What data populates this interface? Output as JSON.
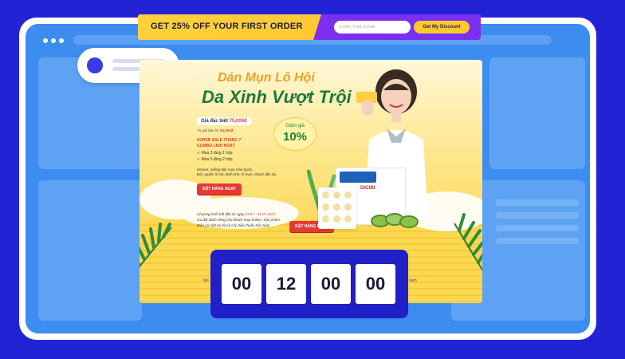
{
  "promo": {
    "headline": "GET 25% OFF YOUR FIRST ORDER",
    "email_placeholder": "Enter Your Email",
    "button_label": "Get My Discount"
  },
  "landing": {
    "title_line1": "Dán Mụn Lô Hội",
    "title_line2": "Da Xinh Vượt Trội",
    "price_label": "Giá đặc biệt",
    "price_value": "75,000đ",
    "old_price_label": "Từ giá bán lẻ:",
    "old_price_value": "94,000đ",
    "discount_label": "Giảm giá",
    "discount_value": "10%",
    "sale_heading_1": "SUPER SALE THÁNG 7",
    "sale_heading_2": "COMBO LINH HOẠT",
    "sale_items": [
      "Mua 3 tặng 1 hộp",
      "Mua 5 tặng 2 hộp"
    ],
    "desc_line1": "Himom, miếng dán mụn Hàn Quốc.",
    "desc_line2": "Độc quyền lô hội, lành tính, trị mụn, nhanh liền da.",
    "cta_primary": "ĐẶT HÀNG NGAY",
    "program_line1_prefix": "Chương trình bắt đầu từ ngày",
    "program_dates": "01.07 - 31.07.2021",
    "program_line2": "Ưu đãi dành riêng cho khách mua online. Sản phẩm",
    "program_line3": "Biện có mặt tại tất cả các hiệu thuốc trên toàn",
    "cta_secondary": "ĐẶT HÀNG NGAY",
    "product_name": "DIGIBI",
    "footer_left": "Me",
    "footer_right": "bám"
  },
  "countdown": [
    "00",
    "12",
    "00",
    "00"
  ],
  "colors": {
    "background": "#2323d6",
    "browser_fill": "#3d8cf0",
    "promo_yellow": "#ffd03c",
    "promo_purple": "#7b2ff0",
    "cta_red": "#e53935",
    "title_green": "#1a7a3c",
    "timer_bg": "#2020c6"
  }
}
